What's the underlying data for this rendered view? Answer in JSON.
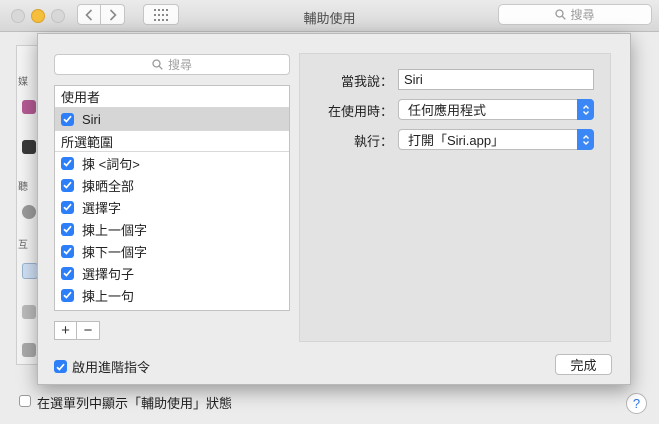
{
  "window": {
    "title": "輔助使用",
    "search_placeholder": "搜尋"
  },
  "sheet": {
    "search_placeholder": "搜尋",
    "groups": [
      {
        "header": "使用者",
        "items": [
          {
            "label": "Siri",
            "checked": true,
            "selected": true
          }
        ]
      },
      {
        "header": "所選範圍",
        "items": [
          {
            "label": "揀 <詞句>",
            "checked": true
          },
          {
            "label": "揀晒全部",
            "checked": true
          },
          {
            "label": "選擇字",
            "checked": true
          },
          {
            "label": "揀上一個字",
            "checked": true
          },
          {
            "label": "揀下一個字",
            "checked": true
          },
          {
            "label": "選擇句子",
            "checked": true
          },
          {
            "label": "揀上一句",
            "checked": true
          }
        ]
      }
    ],
    "add_label": "+",
    "remove_label": "−",
    "enable_label": "啟用進階指令",
    "enable_checked": true,
    "when_i_say_label": "當我說：",
    "when_i_say_value": "Siri",
    "while_using_label": "在使用時：",
    "while_using_value": "任何應用程式",
    "perform_label": "執行：",
    "perform_value": "打開「Siri.app」",
    "done_label": "完成"
  },
  "background": {
    "menu_bar_checkbox_label": "在選單列中顯示「輔助使用」狀態",
    "help_label": "?",
    "sidebar_fragments": [
      "媒",
      "聽",
      "互"
    ]
  },
  "colors": {
    "accent": "#2d7ff9",
    "popup_arrow": "#3b87f5"
  },
  "icons": [
    "back-arrow-icon",
    "forward-arrow-icon",
    "grid-icon",
    "search-icon",
    "checkmark-icon",
    "updown-chevron-icon"
  ]
}
